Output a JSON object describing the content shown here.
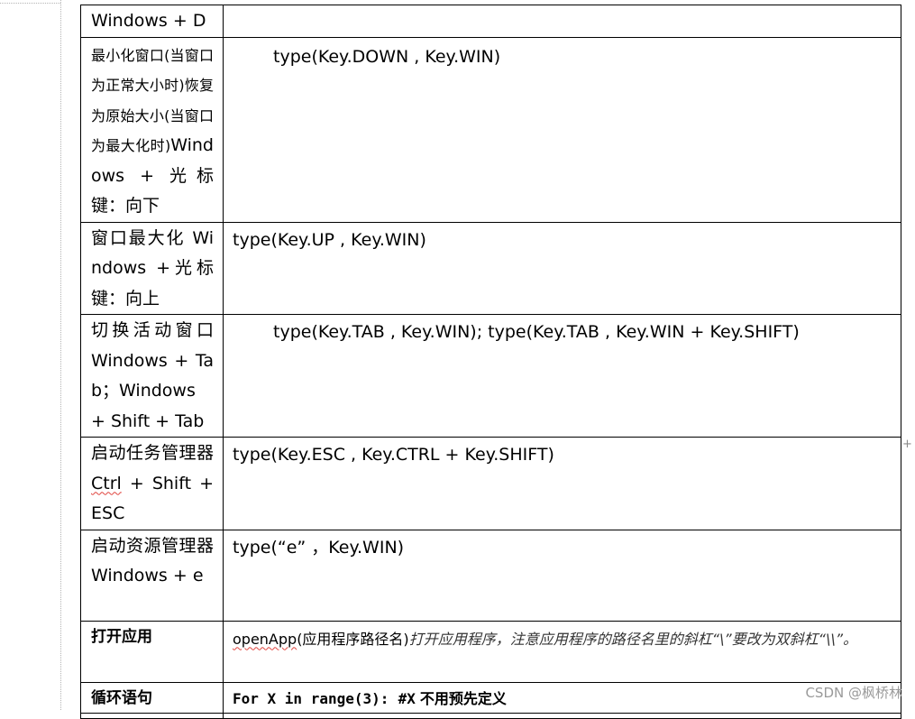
{
  "rows": [
    {
      "shortcut": "Windows + D",
      "code": ""
    },
    {
      "shortcut_small": "最小化窗口(当窗口为正常大小时)恢复为原始大小(当窗口为最大化时)",
      "shortcut_rest": "Windows + 光标键：向下",
      "code": "type(Key.DOWN , Key.WIN)"
    },
    {
      "shortcut": "窗口最大化 Windows +光标键：向上",
      "code": "type(Key.UP , Key.WIN)"
    },
    {
      "shortcut": "切换活动窗口 Windows + Tab；Windows + Shift + Tab",
      "code": "type(Key.TAB , Key.WIN); type(Key.TAB , Key.WIN + Key.SHIFT)"
    },
    {
      "shortcut_a": "启动任务管理器 ",
      "shortcut_ctrl": "Ctrl",
      "shortcut_b": " + Shift + ESC",
      "code": "type(Key.ESC , Key.CTRL + Key.SHIFT)"
    },
    {
      "shortcut": "启动资源管理器 Windows + e",
      "code": "type(“e” ，Key.WIN)"
    },
    {
      "shortcut": "打开应用",
      "code_fn": "openApp",
      "code_args": "(应用程序路径名)",
      "code_note": "打开应用程序，注意应用程序的路径名里的斜杠“\\”要改为双斜杠“\\\\”。"
    },
    {
      "shortcut": "循环语句",
      "code_loop": "For X in range(3):",
      "code_comment_hash": "#X",
      "code_comment": "不用预先定义"
    }
  ],
  "watermark": "CSDN @枫桥林"
}
